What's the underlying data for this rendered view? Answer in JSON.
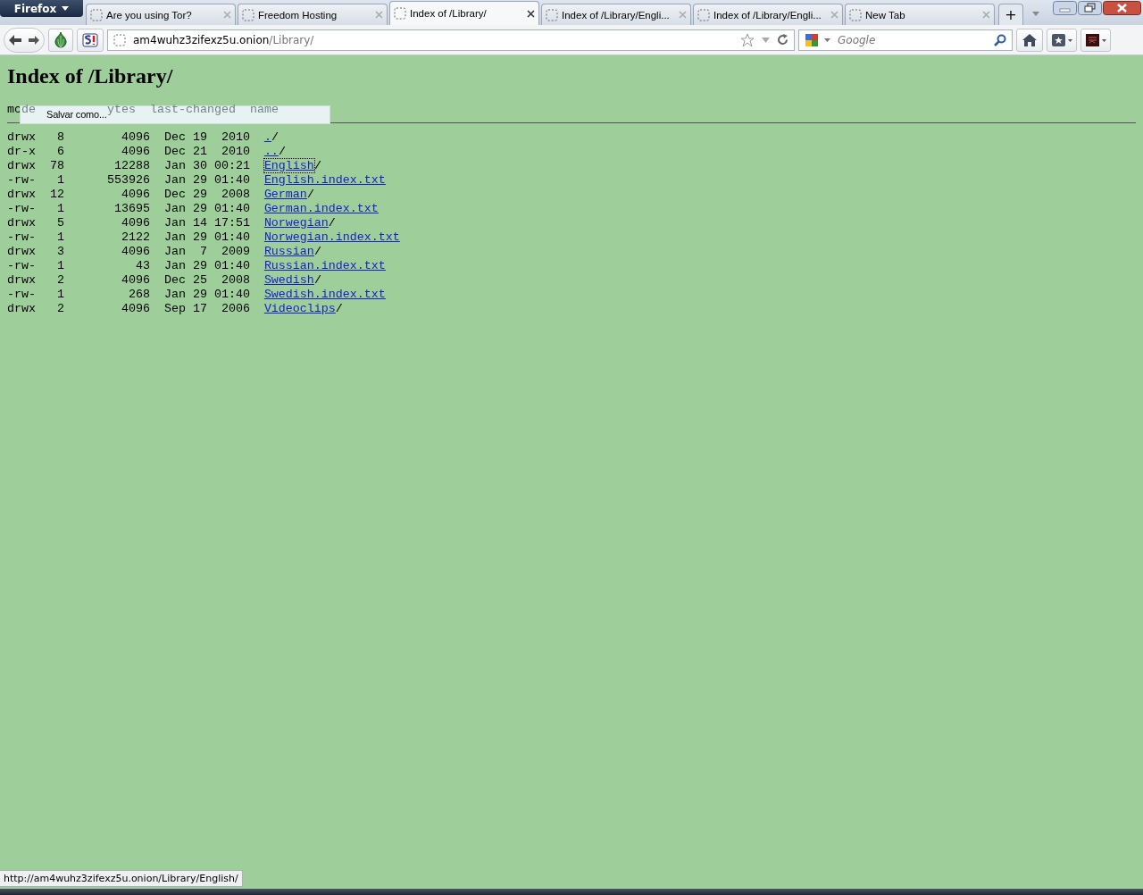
{
  "app_button": "Firefox",
  "tabs": [
    {
      "title": "Are you using Tor?",
      "selected": false
    },
    {
      "title": "Freedom Hosting",
      "selected": false
    },
    {
      "title": "Index of /Library/",
      "selected": true
    },
    {
      "title": "Index of /Library/Engli...",
      "selected": false
    },
    {
      "title": "Index of /Library/Engli...",
      "selected": false
    },
    {
      "title": "New Tab",
      "selected": false
    }
  ],
  "new_tab": "+",
  "address": {
    "host": "am4wuhz3zifexz5u.onion",
    "path": "/Library/"
  },
  "search": {
    "placeholder": "Google"
  },
  "page": {
    "heading": "Index of /Library/",
    "header": [
      {
        "text": "mc",
        "faded": false
      },
      {
        "text": "de",
        "faded": true
      },
      {
        "text": "ytes",
        "faded": true
      },
      {
        "text": "last-changed",
        "faded": true
      },
      {
        "text": "name",
        "faded": true
      }
    ],
    "tooltip": "Salvar como...",
    "rows": [
      {
        "mode": "drwx",
        "links": "8",
        "bytes": "4096",
        "date": "Dec 19  2010",
        "name": ".",
        "suffix": "/",
        "focused": false
      },
      {
        "mode": "dr-x",
        "links": "6",
        "bytes": "4096",
        "date": "Dec 21  2010",
        "name": "..",
        "suffix": "/",
        "focused": false
      },
      {
        "mode": "drwx",
        "links": "78",
        "bytes": "12288",
        "date": "Jan 30 00:21",
        "name": "English",
        "suffix": "/",
        "focused": true
      },
      {
        "mode": "-rw-",
        "links": "1",
        "bytes": "553926",
        "date": "Jan 29 01:40",
        "name": "English.index.txt",
        "suffix": "",
        "focused": false
      },
      {
        "mode": "drwx",
        "links": "12",
        "bytes": "4096",
        "date": "Dec 29  2008",
        "name": "German",
        "suffix": "/",
        "focused": false
      },
      {
        "mode": "-rw-",
        "links": "1",
        "bytes": "13695",
        "date": "Jan 29 01:40",
        "name": "German.index.txt",
        "suffix": "",
        "focused": false
      },
      {
        "mode": "drwx",
        "links": "5",
        "bytes": "4096",
        "date": "Jan 14 17:51",
        "name": "Norwegian",
        "suffix": "/",
        "focused": false
      },
      {
        "mode": "-rw-",
        "links": "1",
        "bytes": "2122",
        "date": "Jan 29 01:40",
        "name": "Norwegian.index.txt",
        "suffix": "",
        "focused": false
      },
      {
        "mode": "drwx",
        "links": "3",
        "bytes": "4096",
        "date": "Jan  7  2009",
        "name": "Russian",
        "suffix": "/",
        "focused": false
      },
      {
        "mode": "-rw-",
        "links": "1",
        "bytes": "43",
        "date": "Jan 29 01:40",
        "name": "Russian.index.txt",
        "suffix": "",
        "focused": false
      },
      {
        "mode": "drwx",
        "links": "2",
        "bytes": "4096",
        "date": "Dec 25  2008",
        "name": "Swedish",
        "suffix": "/",
        "focused": false
      },
      {
        "mode": "-rw-",
        "links": "1",
        "bytes": "268",
        "date": "Jan 29 01:40",
        "name": "Swedish.index.txt",
        "suffix": "",
        "focused": false
      },
      {
        "mode": "drwx",
        "links": "2",
        "bytes": "4096",
        "date": "Sep 17  2006",
        "name": "Videoclips",
        "suffix": "/",
        "focused": false
      }
    ]
  },
  "status_url": "http://am4wuhz3zifexz5u.onion/Library/English/"
}
